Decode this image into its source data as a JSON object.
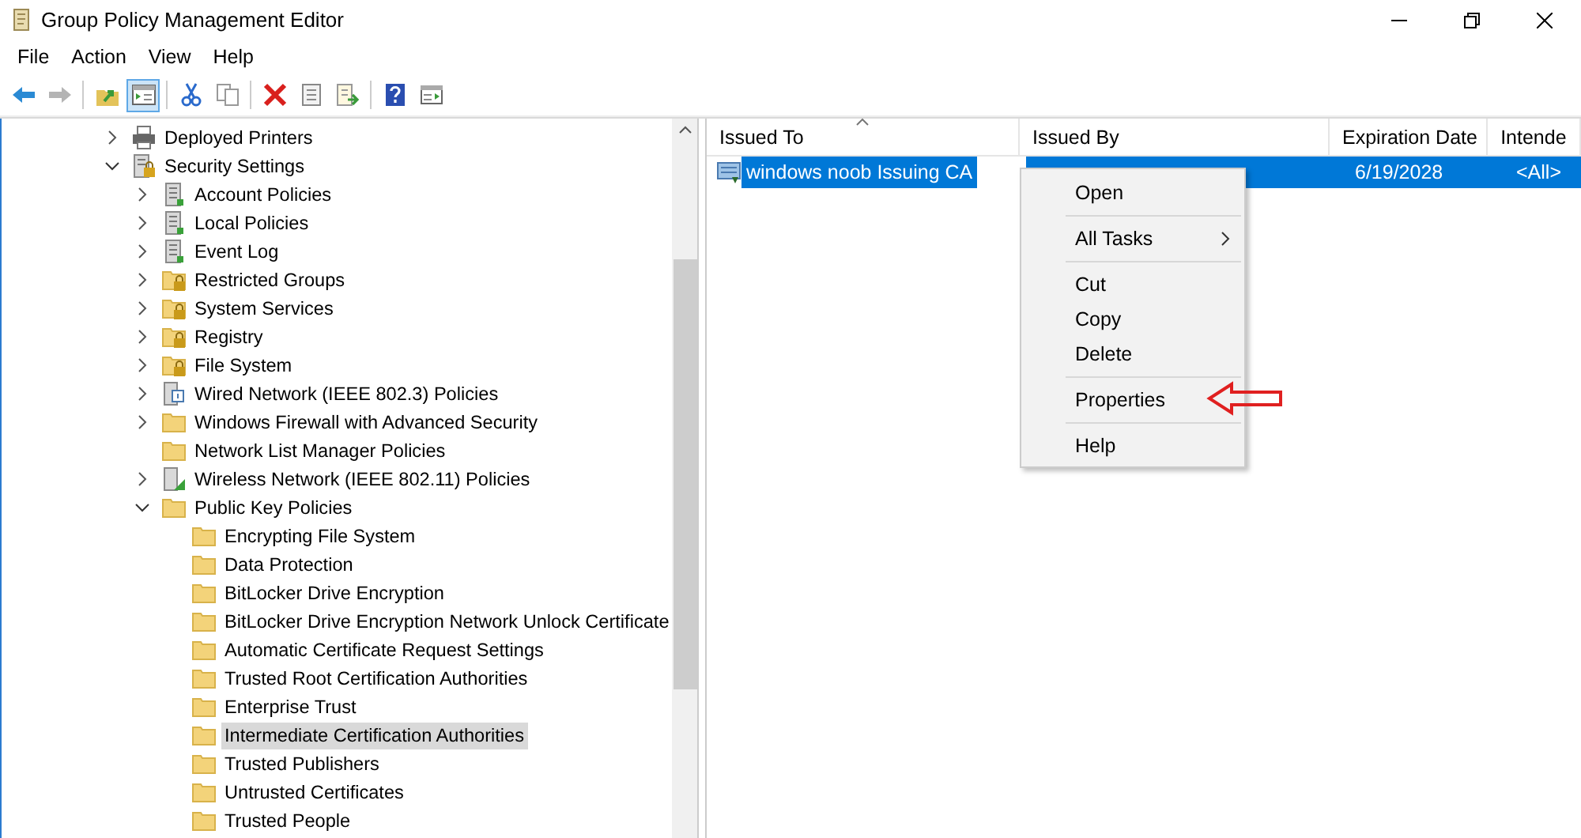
{
  "window": {
    "title": "Group Policy Management Editor"
  },
  "menu_bar": [
    "File",
    "Action",
    "View",
    "Help"
  ],
  "toolbar": [
    {
      "kind": "back",
      "disabled": false,
      "pressed": false
    },
    {
      "kind": "forward",
      "disabled": true,
      "pressed": false
    },
    {
      "kind": "separator"
    },
    {
      "kind": "up",
      "disabled": false,
      "pressed": false
    },
    {
      "kind": "show-tree",
      "disabled": false,
      "pressed": true
    },
    {
      "kind": "separator"
    },
    {
      "kind": "cut",
      "disabled": false,
      "pressed": false
    },
    {
      "kind": "copy",
      "disabled": false,
      "pressed": false
    },
    {
      "kind": "separator"
    },
    {
      "kind": "delete",
      "disabled": false,
      "pressed": false
    },
    {
      "kind": "properties",
      "disabled": false,
      "pressed": false
    },
    {
      "kind": "export",
      "disabled": false,
      "pressed": false
    },
    {
      "kind": "separator"
    },
    {
      "kind": "help",
      "disabled": false,
      "pressed": false
    },
    {
      "kind": "show-action",
      "disabled": false,
      "pressed": false
    }
  ],
  "tree": [
    {
      "label": "Deployed Printers",
      "kind": "printer",
      "has_children": true,
      "expanded": false,
      "selected": false
    },
    {
      "label": "Security Settings",
      "kind": "security",
      "has_children": true,
      "expanded": true,
      "selected": false,
      "children": [
        {
          "label": "Account Policies",
          "kind": "policy",
          "has_children": true,
          "expanded": false,
          "selected": false
        },
        {
          "label": "Local Policies",
          "kind": "policy",
          "has_children": true,
          "expanded": false,
          "selected": false
        },
        {
          "label": "Event Log",
          "kind": "policy",
          "has_children": true,
          "expanded": false,
          "selected": false
        },
        {
          "label": "Restricted Groups",
          "kind": "locked-folder",
          "has_children": true,
          "expanded": false,
          "selected": false
        },
        {
          "label": "System Services",
          "kind": "locked-folder",
          "has_children": true,
          "expanded": false,
          "selected": false
        },
        {
          "label": "Registry",
          "kind": "locked-folder",
          "has_children": true,
          "expanded": false,
          "selected": false
        },
        {
          "label": "File System",
          "kind": "locked-folder",
          "has_children": true,
          "expanded": false,
          "selected": false
        },
        {
          "label": "Wired Network (IEEE 802.3) Policies",
          "kind": "network",
          "has_children": true,
          "expanded": false,
          "selected": false
        },
        {
          "label": "Windows Firewall with Advanced Security",
          "kind": "folder",
          "has_children": true,
          "expanded": false,
          "selected": false
        },
        {
          "label": "Network List Manager Policies",
          "kind": "folder",
          "has_children": false,
          "expanded": false,
          "selected": false
        },
        {
          "label": "Wireless Network (IEEE 802.11) Policies",
          "kind": "wireless",
          "has_children": true,
          "expanded": false,
          "selected": false
        },
        {
          "label": "Public Key Policies",
          "kind": "folder",
          "has_children": true,
          "expanded": true,
          "selected": false,
          "children": [
            {
              "label": "Encrypting File System",
              "kind": "folder",
              "has_children": false,
              "expanded": false,
              "selected": false
            },
            {
              "label": "Data Protection",
              "kind": "folder",
              "has_children": false,
              "expanded": false,
              "selected": false
            },
            {
              "label": "BitLocker Drive Encryption",
              "kind": "folder",
              "has_children": false,
              "expanded": false,
              "selected": false
            },
            {
              "label": "BitLocker Drive Encryption Network Unlock Certificate",
              "kind": "folder",
              "has_children": false,
              "expanded": false,
              "selected": false
            },
            {
              "label": "Automatic Certificate Request Settings",
              "kind": "folder",
              "has_children": false,
              "expanded": false,
              "selected": false
            },
            {
              "label": "Trusted Root Certification Authorities",
              "kind": "folder",
              "has_children": false,
              "expanded": false,
              "selected": false
            },
            {
              "label": "Enterprise Trust",
              "kind": "folder",
              "has_children": false,
              "expanded": false,
              "selected": false
            },
            {
              "label": "Intermediate Certification Authorities",
              "kind": "folder",
              "has_children": false,
              "expanded": false,
              "selected": true
            },
            {
              "label": "Trusted Publishers",
              "kind": "folder",
              "has_children": false,
              "expanded": false,
              "selected": false
            },
            {
              "label": "Untrusted Certificates",
              "kind": "folder",
              "has_children": false,
              "expanded": false,
              "selected": false
            },
            {
              "label": "Trusted People",
              "kind": "folder",
              "has_children": false,
              "expanded": false,
              "selected": false
            }
          ]
        }
      ]
    }
  ],
  "table": {
    "columns": [
      {
        "label": "Issued To",
        "sorted": true
      },
      {
        "label": "Issued By",
        "sorted": false
      },
      {
        "label": "Expiration Date",
        "sorted": false
      },
      {
        "label": "Intende",
        "sorted": false
      }
    ],
    "rows": [
      {
        "cells": [
          "windows noob Issuing CA",
          "",
          "6/19/2028",
          "<All>"
        ],
        "selected": true
      }
    ]
  },
  "context_menu": [
    {
      "kind": "item",
      "label": "Open",
      "submenu": false,
      "marked": false
    },
    {
      "kind": "separator"
    },
    {
      "kind": "item",
      "label": "All Tasks",
      "submenu": true,
      "marked": false
    },
    {
      "kind": "separator"
    },
    {
      "kind": "item",
      "label": "Cut",
      "submenu": false,
      "marked": false
    },
    {
      "kind": "item",
      "label": "Copy",
      "submenu": false,
      "marked": false
    },
    {
      "kind": "item",
      "label": "Delete",
      "submenu": false,
      "marked": false
    },
    {
      "kind": "separator"
    },
    {
      "kind": "item",
      "label": "Properties",
      "submenu": false,
      "marked": true
    },
    {
      "kind": "separator"
    },
    {
      "kind": "item",
      "label": "Help",
      "submenu": false,
      "marked": false
    }
  ]
}
